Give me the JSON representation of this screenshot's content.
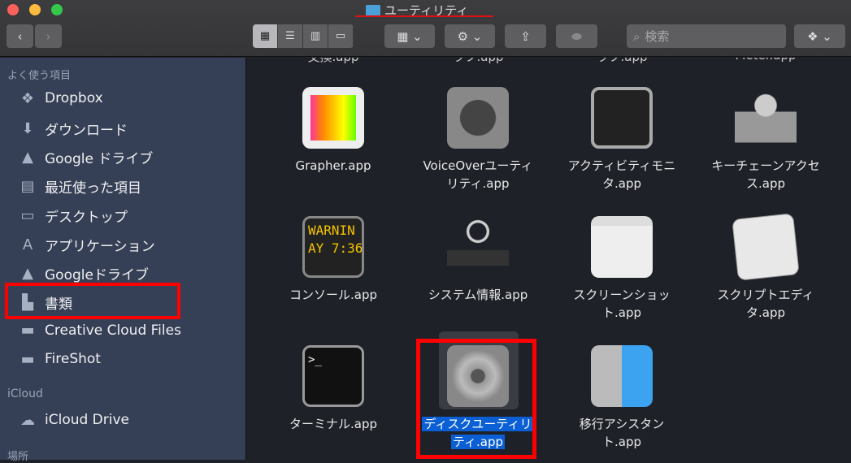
{
  "window": {
    "title": "ユーティリティ",
    "title_icon": "utilities-folder-icon"
  },
  "toolbar": {
    "back": "‹",
    "forward": "›",
    "view_modes": [
      "icon-view",
      "list-view",
      "column-view",
      "gallery-view"
    ],
    "active_view": "icon-view",
    "search_placeholder": "検索"
  },
  "sidebar": {
    "favorites_header": "よく使う項目",
    "favorites": [
      {
        "label": "Dropbox",
        "icon": "dropbox-icon"
      },
      {
        "label": "ダウンロード",
        "icon": "download-icon"
      },
      {
        "label": "Google ドライブ",
        "icon": "google-drive-icon"
      },
      {
        "label": "最近使った項目",
        "icon": "recents-icon"
      },
      {
        "label": "デスクトップ",
        "icon": "desktop-icon"
      },
      {
        "label": "アプリケーション",
        "icon": "applications-icon"
      },
      {
        "label": "Googleドライブ",
        "icon": "google-drive-icon"
      },
      {
        "label": "書類",
        "icon": "documents-icon"
      },
      {
        "label": "Creative Cloud Files",
        "icon": "folder-icon"
      },
      {
        "label": "FireShot",
        "icon": "folder-icon"
      }
    ],
    "icloud_header": "iCloud",
    "icloud": [
      {
        "label": "iCloud Drive",
        "icon": "cloud-icon"
      }
    ],
    "locations_header": "場所"
  },
  "main": {
    "clipped_row": [
      "交換.app",
      "ラフ.app",
      "ラフ.app",
      "Meter.app"
    ],
    "items": [
      {
        "l1": "Grapher.app",
        "l2": "",
        "icon": "grapher-icon"
      },
      {
        "l1": "VoiceOverユーティ",
        "l2": "リティ.app",
        "icon": "voiceover-icon"
      },
      {
        "l1": "アクティビティモニ",
        "l2": "タ.app",
        "icon": "activity-monitor-icon"
      },
      {
        "l1": "キーチェーンアクセ",
        "l2": "ス.app",
        "icon": "keychain-icon"
      },
      {
        "l1": "コンソール.app",
        "l2": "",
        "icon": "console-icon",
        "console_text": "WARNIN\nAY 7:36"
      },
      {
        "l1": "システム情報.app",
        "l2": "",
        "icon": "system-info-icon"
      },
      {
        "l1": "スクリーンショッ",
        "l2": "ト.app",
        "icon": "screenshot-icon"
      },
      {
        "l1": "スクリプトエディ",
        "l2": "タ.app",
        "icon": "script-editor-icon"
      },
      {
        "l1": "ターミナル.app",
        "l2": "",
        "icon": "terminal-icon"
      },
      {
        "l1": "ディスクユーティリ",
        "l2": "ティ.app",
        "icon": "disk-utility-icon",
        "selected": true
      },
      {
        "l1": "移行アシスタン",
        "l2": "ト.app",
        "icon": "migration-assistant-icon"
      }
    ]
  },
  "colors": {
    "highlight": "#ff0000",
    "selection": "#0a5fd4",
    "sidebar": "#353f55"
  }
}
